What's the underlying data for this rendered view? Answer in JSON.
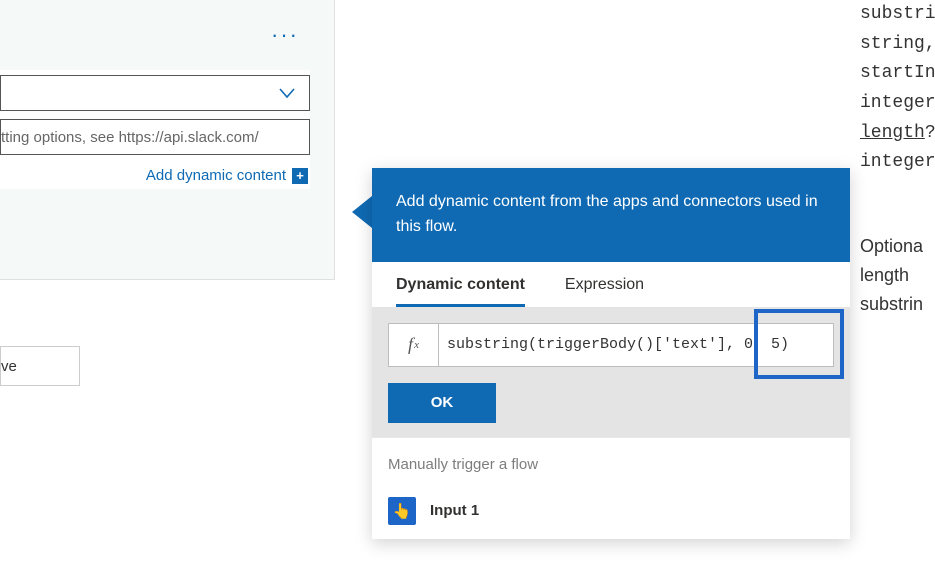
{
  "left": {
    "ellipsis": "···",
    "dropdown_placeholder": "",
    "text_placeholder": "tting options, see https://api.slack.com/",
    "add_dynamic_link": "Add dynamic content",
    "plus_glyph": "+",
    "save_button": "ve"
  },
  "flyout": {
    "header_text": "Add dynamic content from the apps and connectors used in this flow.",
    "tabs": {
      "dynamic": "Dynamic content",
      "expression": "Expression"
    },
    "fx_label_main": "f",
    "fx_label_sub": "x",
    "expression_value": "substring(triggerBody()['text'], 0, 5)",
    "ok_button": "OK",
    "section_title": "Manually trigger a flow",
    "input1_icon": "👆",
    "input1_label": "Input 1"
  },
  "doc": {
    "l1": "substri",
    "l2": "string,",
    "l3": "startIn",
    "l4": "integer",
    "l5_u": "length",
    "l5_q": "?",
    "l6": "integer",
    "p1": "Optiona",
    "p2": "length",
    "p3": "substrin"
  }
}
